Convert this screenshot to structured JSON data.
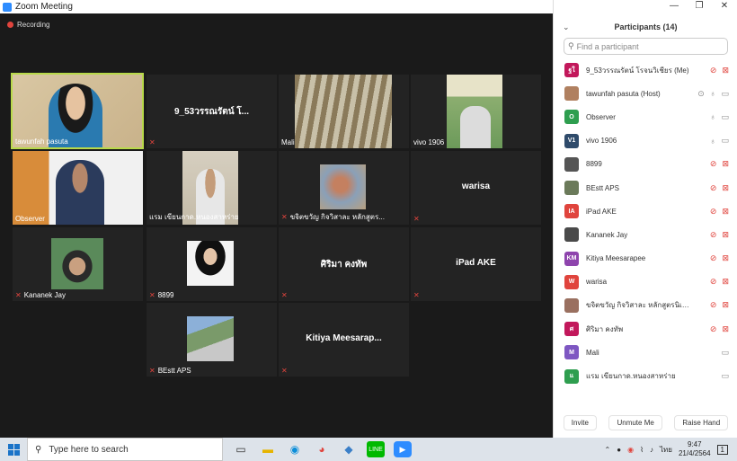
{
  "window": {
    "title": "Zoom Meeting"
  },
  "recording": {
    "label": "Recording"
  },
  "tiles": [
    {
      "id": "t1",
      "name": "tawunfah pasuta",
      "center": "",
      "muted": false,
      "active": true
    },
    {
      "id": "t2",
      "name": "",
      "center": "9_53วรรณรัตน์  โ...",
      "muted": true
    },
    {
      "id": "t3",
      "name": "Mali",
      "center": "",
      "muted": false
    },
    {
      "id": "t4",
      "name": "vivo 1906",
      "center": "",
      "muted": false
    },
    {
      "id": "t5",
      "name": "Observer",
      "center": "",
      "muted": false
    },
    {
      "id": "t6",
      "name": "แรม เขียนกาด.หนองสาหร่าย",
      "center": "",
      "muted": false
    },
    {
      "id": "t7",
      "name": "ขจิตขวัญ กิจวิสาละ หลักสูตร...",
      "center": "",
      "muted": true
    },
    {
      "id": "t8",
      "name": "",
      "center": "warisa",
      "muted": true
    },
    {
      "id": "t9",
      "name": "Kananek Jay",
      "center": "",
      "muted": true
    },
    {
      "id": "t10",
      "name": "8899",
      "center": "",
      "muted": true
    },
    {
      "id": "t11",
      "name": "",
      "center": "ศิริมา คงทัพ",
      "muted": true
    },
    {
      "id": "t12",
      "name": "",
      "center": "iPad AKE",
      "muted": true
    },
    {
      "id": "t13",
      "name": "BEstt APS",
      "center": "",
      "muted": true
    },
    {
      "id": "t14",
      "name": "",
      "center": "Kitiya  Meesarap...",
      "muted": true
    }
  ],
  "participants_panel": {
    "title": "Participants (14)",
    "search_placeholder": "Find a participant",
    "items": [
      {
        "avatar": "ฐใ",
        "color": "#c2185b",
        "name": "9_53วรรณรัตน์  โรจนวิเชียร (Me)",
        "mic": "muted",
        "video": "off"
      },
      {
        "avatar": "",
        "color": "#b08060",
        "name": "tawunfah pasuta (Host)",
        "mic": "on",
        "video": "on",
        "share": true
      },
      {
        "avatar": "O",
        "color": "#2e9e4f",
        "name": "Observer",
        "mic": "on",
        "video": "on"
      },
      {
        "avatar": "V1",
        "color": "#2f4b6b",
        "name": "vivo 1906",
        "mic": "on",
        "video": "on"
      },
      {
        "avatar": "",
        "color": "#555555",
        "name": "8899",
        "mic": "muted",
        "video": "off"
      },
      {
        "avatar": "",
        "color": "#6b7a5a",
        "name": "BEstt APS",
        "mic": "muted",
        "video": "off"
      },
      {
        "avatar": "IA",
        "color": "#e0443d",
        "name": "iPad AKE",
        "mic": "muted",
        "video": "off"
      },
      {
        "avatar": "",
        "color": "#4a4a4a",
        "name": "Kananek Jay",
        "mic": "muted",
        "video": "off"
      },
      {
        "avatar": "KM",
        "color": "#8e44ad",
        "name": "Kitiya Meesarapee",
        "mic": "muted",
        "video": "off"
      },
      {
        "avatar": "W",
        "color": "#e0443d",
        "name": "warisa",
        "mic": "muted",
        "video": "off"
      },
      {
        "avatar": "",
        "color": "#9a7060",
        "name": "ขจิตขวัญ กิจวิสาละ หลักสูตรนิเทศศาสต...",
        "mic": "muted",
        "video": "off"
      },
      {
        "avatar": "ศ",
        "color": "#c2185b",
        "name": "ศิริมา คงทัพ",
        "mic": "muted",
        "video": "off"
      },
      {
        "avatar": "M",
        "color": "#7e57c2",
        "name": "Mali",
        "mic": "none",
        "video": "on"
      },
      {
        "avatar": "แ",
        "color": "#2e9e4f",
        "name": "แรม เขียนกาด.หนองสาหร่าย",
        "mic": "none",
        "video": "on"
      }
    ],
    "buttons": {
      "invite": "Invite",
      "unmute": "Unmute Me",
      "raise": "Raise Hand"
    }
  },
  "taskbar": {
    "search_placeholder": "Type here to search",
    "lang": "ไทย",
    "time": "9:47",
    "date": "21/4/2564",
    "notif_count": "1"
  }
}
